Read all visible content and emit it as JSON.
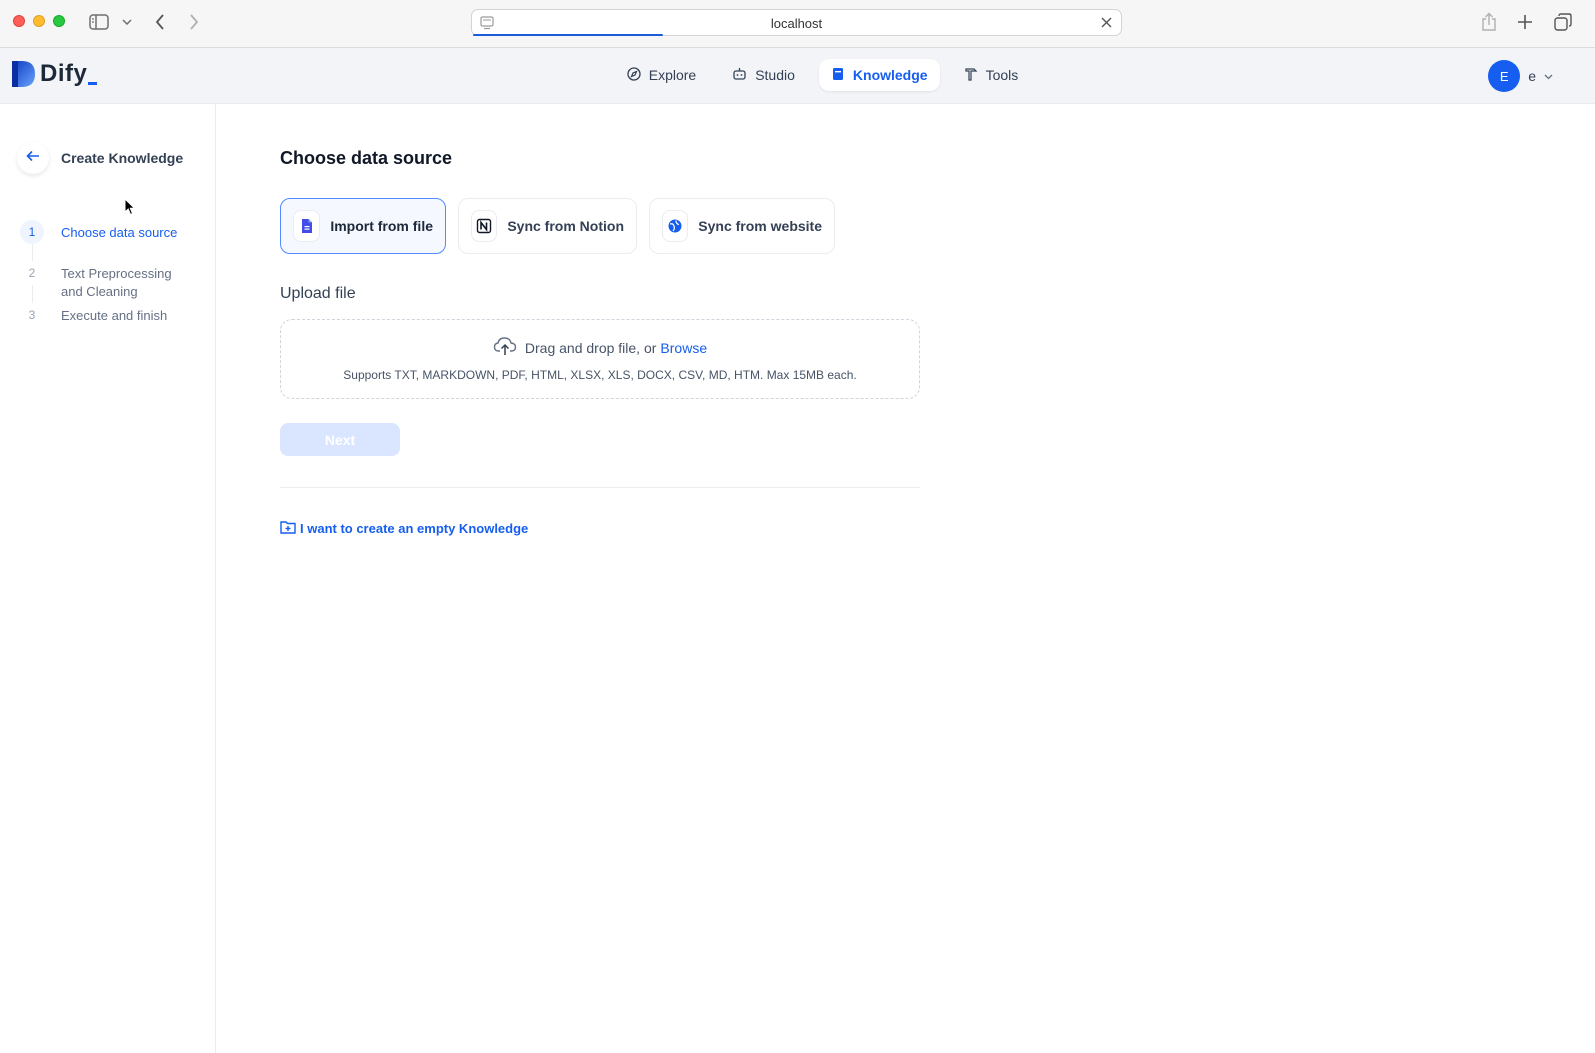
{
  "browser": {
    "url": "localhost"
  },
  "app": {
    "logo_text": "Dify",
    "nav": [
      {
        "label": "Explore",
        "icon": "compass-icon"
      },
      {
        "label": "Studio",
        "icon": "robot-icon"
      },
      {
        "label": "Knowledge",
        "icon": "book-icon",
        "active": true
      },
      {
        "label": "Tools",
        "icon": "hammer-icon"
      }
    ],
    "user": {
      "avatar_initial": "E",
      "name": "e"
    }
  },
  "sidebar": {
    "title": "Create Knowledge",
    "steps": [
      {
        "num": "1",
        "label": "Choose data source",
        "active": true
      },
      {
        "num": "2",
        "label": "Text Preprocessing and Cleaning"
      },
      {
        "num": "3",
        "label": "Execute and finish"
      }
    ]
  },
  "main": {
    "heading": "Choose data source",
    "sources": [
      {
        "label": "Import from file",
        "icon": "file-icon",
        "active": true
      },
      {
        "label": "Sync from Notion",
        "icon": "notion-icon"
      },
      {
        "label": "Sync from website",
        "icon": "globe-icon"
      }
    ],
    "upload_label": "Upload file",
    "dropzone": {
      "text": "Drag and drop file, or",
      "browse": "Browse",
      "supports": "Supports TXT, MARKDOWN, PDF, HTML, XLSX, XLS, DOCX, CSV, MD, HTM. Max 15MB each."
    },
    "next_label": "Next",
    "empty_link": "I want to create an empty Knowledge"
  },
  "colors": {
    "accent": "#155eef",
    "active_bg": "#f5f8ff",
    "disabled_button": "#dae6ff"
  }
}
